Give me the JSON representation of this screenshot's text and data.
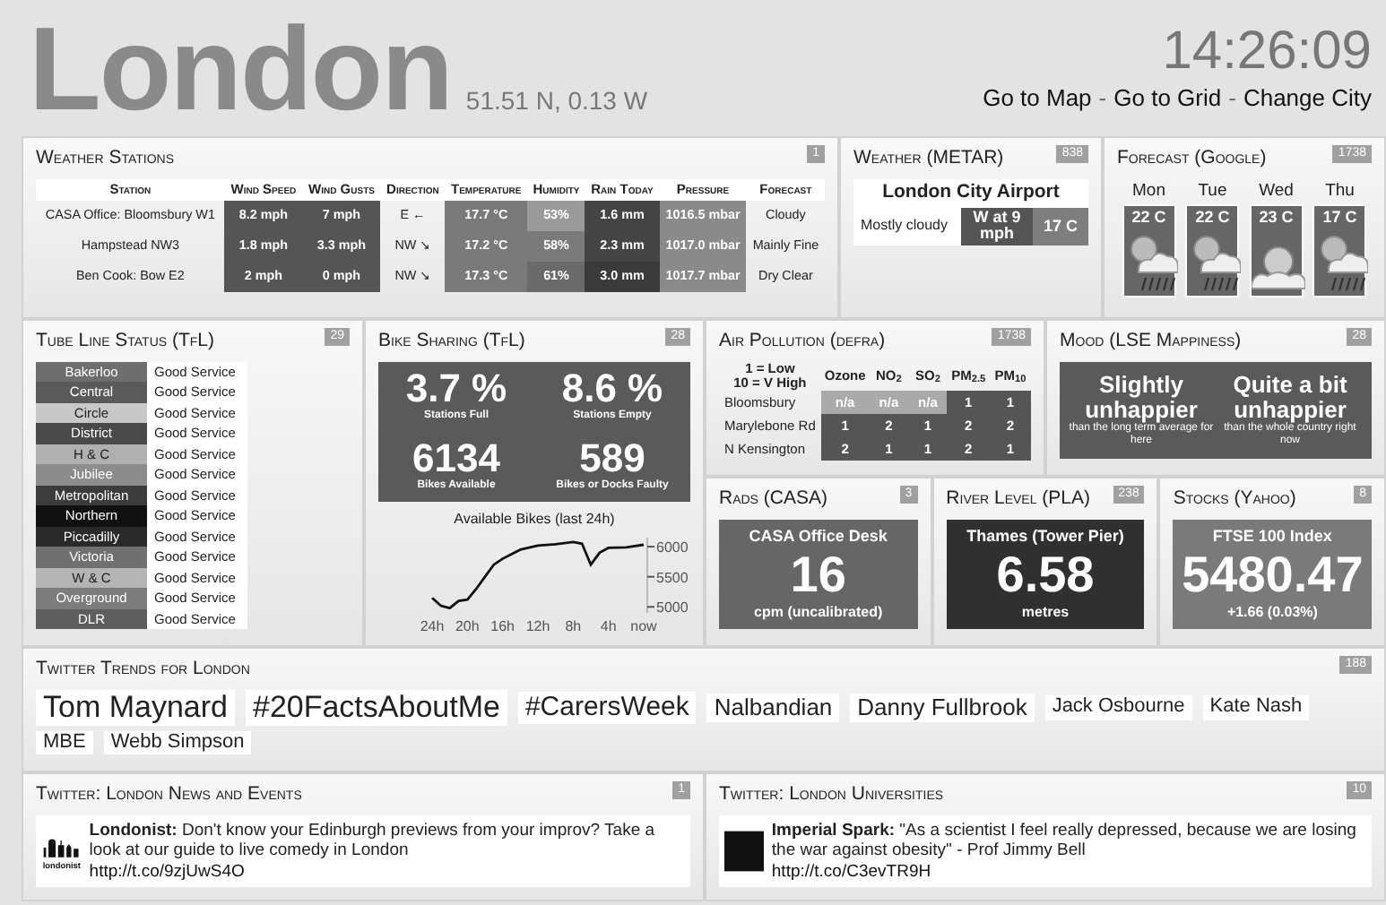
{
  "header": {
    "city": "London",
    "coords": "51.51 N, 0.13 W",
    "time": "14:26:09",
    "nav": [
      {
        "kind": "link",
        "text": "Go to Map"
      },
      {
        "kind": "separator",
        "text": "-"
      },
      {
        "kind": "link",
        "text": "Go to Grid"
      },
      {
        "kind": "separator",
        "text": "-"
      },
      {
        "kind": "link",
        "text": "Change City"
      }
    ]
  },
  "weather_stations": {
    "title": "Weather Stations",
    "badge": "1",
    "columns": [
      "Station",
      "Wind Speed",
      "Wind Gusts",
      "Direction",
      "Temperature",
      "Humidity",
      "Rain Today",
      "Pressure",
      "Forecast"
    ],
    "rows": [
      {
        "cells": [
          {
            "text": "CASA Office: Bloomsbury W1"
          },
          {
            "text": "8.2 mph",
            "color": "#555555"
          },
          {
            "text": "7 mph",
            "color": "#555555"
          },
          {
            "text": "E ←"
          },
          {
            "text": "17.7 °C",
            "color": "#7a7a7a"
          },
          {
            "text": "53%",
            "color": "#9a9a9a"
          },
          {
            "text": "1.6 mm",
            "color": "#444444"
          },
          {
            "text": "1016.5 mbar",
            "color": "#8a8a8a"
          },
          {
            "text": "Cloudy"
          }
        ]
      },
      {
        "cells": [
          {
            "text": "Hampstead NW3"
          },
          {
            "text": "1.8 mph",
            "color": "#555555"
          },
          {
            "text": "3.3 mph",
            "color": "#555555"
          },
          {
            "text": "NW ↘"
          },
          {
            "text": "17.2 °C",
            "color": "#7a7a7a"
          },
          {
            "text": "58%",
            "color": "#7a7a7a"
          },
          {
            "text": "2.3 mm",
            "color": "#444444"
          },
          {
            "text": "1017.0 mbar",
            "color": "#8a8a8a"
          },
          {
            "text": "Mainly Fine"
          }
        ]
      },
      {
        "cells": [
          {
            "text": "Ben Cook: Bow E2"
          },
          {
            "text": "2 mph",
            "color": "#555555"
          },
          {
            "text": "0 mph",
            "color": "#555555"
          },
          {
            "text": "NW ↘"
          },
          {
            "text": "17.3 °C",
            "color": "#7a7a7a"
          },
          {
            "text": "61%",
            "color": "#6a6a6a"
          },
          {
            "text": "3.0 mm",
            "color": "#3a3a3a"
          },
          {
            "text": "1017.7 mbar",
            "color": "#8a8a8a"
          },
          {
            "text": "Dry Clear"
          }
        ]
      }
    ]
  },
  "metar": {
    "title": "Weather (METAR)",
    "badge": "838",
    "station": "London City Airport",
    "condition": "Mostly cloudy",
    "wind": "W at 9 mph",
    "temperature": "17 C"
  },
  "forecast": {
    "title": "Forecast (Google)",
    "badge": "1738",
    "days": [
      {
        "day": "Mon",
        "temp": "22 C",
        "kind": "rain"
      },
      {
        "day": "Tue",
        "temp": "22 C",
        "kind": "rain"
      },
      {
        "day": "Wed",
        "temp": "23 C",
        "kind": "cloudy"
      },
      {
        "day": "Thu",
        "temp": "17 C",
        "kind": "rain"
      }
    ]
  },
  "tube": {
    "title": "Tube Line Status (TfL)",
    "badge": "29",
    "lines": [
      {
        "name": "Bakerloo",
        "status": "Good Service",
        "color": "#6e6e6e"
      },
      {
        "name": "Central",
        "status": "Good Service",
        "color": "#5a5a5a"
      },
      {
        "name": "Circle",
        "status": "Good Service",
        "color": "#c8c8c8"
      },
      {
        "name": "District",
        "status": "Good Service",
        "color": "#4a4a4a"
      },
      {
        "name": "H & C",
        "status": "Good Service",
        "color": "#b0b0b0"
      },
      {
        "name": "Jubilee",
        "status": "Good Service",
        "color": "#8c8c8c"
      },
      {
        "name": "Metropolitan",
        "status": "Good Service",
        "color": "#3c3c3c"
      },
      {
        "name": "Northern",
        "status": "Good Service",
        "color": "#111111"
      },
      {
        "name": "Piccadilly",
        "status": "Good Service",
        "color": "#2a2a2a"
      },
      {
        "name": "Victoria",
        "status": "Good Service",
        "color": "#707070"
      },
      {
        "name": "W & C",
        "status": "Good Service",
        "color": "#b4b4b4"
      },
      {
        "name": "Overground",
        "status": "Good Service",
        "color": "#7c7c7c"
      },
      {
        "name": "DLR",
        "status": "Good Service",
        "color": "#5e5e5e"
      }
    ]
  },
  "bikes": {
    "title": "Bike Sharing (TfL)",
    "badge": "28",
    "stats": [
      {
        "value": "3.7 %",
        "label": "Stations Full"
      },
      {
        "value": "8.6 %",
        "label": "Stations Empty"
      },
      {
        "value": "6134",
        "label": "Bikes Available"
      },
      {
        "value": "589",
        "label": "Bikes or Docks Faulty"
      }
    ],
    "chart_data": {
      "type": "line",
      "title": "Available Bikes (last 24h)",
      "x": [
        -24,
        -23,
        -22,
        -21,
        -20,
        -19,
        -18,
        -17,
        -16,
        -14,
        -12,
        -10,
        -8,
        -7,
        -6,
        -5,
        -4,
        -2,
        0
      ],
      "series": [
        {
          "color": "#111111",
          "values": [
            5150,
            5020,
            4980,
            5100,
            5120,
            5300,
            5500,
            5700,
            5800,
            5950,
            6020,
            6040,
            6080,
            6050,
            5700,
            5900,
            5980,
            5990,
            6030
          ]
        }
      ],
      "xlim": [
        -24,
        0
      ],
      "ylim": [
        4900,
        6150
      ],
      "xticks": [
        {
          "value": -24,
          "label": "24h"
        },
        {
          "value": -20,
          "label": "20h"
        },
        {
          "value": -16,
          "label": "16h"
        },
        {
          "value": -12,
          "label": "12h"
        },
        {
          "value": -8,
          "label": "8h"
        },
        {
          "value": -4,
          "label": "4h"
        },
        {
          "value": 0,
          "label": "now"
        }
      ],
      "yticks": [
        6000,
        5500,
        5000
      ]
    }
  },
  "air": {
    "title": "Air Pollution (defra)",
    "badge": "1738",
    "legend": [
      "1 = Low",
      "10 = V High"
    ],
    "columns": [
      "Ozone",
      "NO$_{2}$",
      "SO$_{2}$",
      "PM$_{2.5}$",
      "PM$_{10}$"
    ],
    "rows": [
      {
        "site": "Bloomsbury",
        "cells": [
          {
            "text": "n/a",
            "color": "#aaaaaa"
          },
          {
            "text": "n/a",
            "color": "#aaaaaa"
          },
          {
            "text": "n/a",
            "color": "#aaaaaa"
          },
          {
            "text": "1",
            "color": "#555555"
          },
          {
            "text": "1",
            "color": "#555555"
          }
        ]
      },
      {
        "site": "Marylebone Rd",
        "cells": [
          {
            "text": "1",
            "color": "#555555"
          },
          {
            "text": "2",
            "color": "#555555"
          },
          {
            "text": "1",
            "color": "#555555"
          },
          {
            "text": "2",
            "color": "#555555"
          },
          {
            "text": "2",
            "color": "#555555"
          }
        ]
      },
      {
        "site": "N Kensington",
        "cells": [
          {
            "text": "2",
            "color": "#555555"
          },
          {
            "text": "1",
            "color": "#555555"
          },
          {
            "text": "1",
            "color": "#555555"
          },
          {
            "text": "2",
            "color": "#555555"
          },
          {
            "text": "1",
            "color": "#555555"
          }
        ]
      }
    ]
  },
  "mood": {
    "title": "Mood (LSE Mappiness)",
    "badge": "28",
    "items": [
      {
        "headline": "Slightly unhappier",
        "detail": "than the long term average for here"
      },
      {
        "headline": "Quite a bit unhappier",
        "detail": "than the whole country right now"
      }
    ]
  },
  "gauges": [
    {
      "title": "Rads (CASA)",
      "badge": "3",
      "label": "CASA Office Desk",
      "value": "16",
      "unit": "cpm (uncalibrated)",
      "color": "#666666"
    },
    {
      "title": "River Level (PLA)",
      "badge": "238",
      "label": "Thames (Tower Pier)",
      "value": "6.58",
      "unit": "metres",
      "color": "#303030"
    },
    {
      "title": "Stocks (Yahoo)",
      "badge": "8",
      "label": "FTSE 100 Index",
      "value": "5480.47",
      "unit": "+1.66 (0.03%)",
      "color": "#7a7a7a"
    }
  ],
  "trends": {
    "title": "Twitter Trends for London",
    "badge": "188",
    "items": [
      {
        "text": "Tom Maynard",
        "kind": "xl"
      },
      {
        "text": "#20FactsAboutMe",
        "kind": "xl"
      },
      {
        "text": "#CarersWeek",
        "kind": "l"
      },
      {
        "text": "Nalbandian",
        "kind": "m"
      },
      {
        "text": "Danny Fullbrook",
        "kind": "m"
      },
      {
        "text": "Jack Osbourne",
        "kind": "s"
      },
      {
        "text": "Kate Nash",
        "kind": "s"
      },
      {
        "text": "MBE",
        "kind": "s"
      },
      {
        "text": "Webb Simpson",
        "kind": "s"
      }
    ]
  },
  "tweets": [
    {
      "title": "Twitter: London News and Events",
      "badge": "1",
      "kind": "logo",
      "logo_text": "londonist",
      "text": "**Londonist:** Don't know your Edinburgh previews from your improv? Take a look at our guide to live comedy in London",
      "link": "http://t.co/9zjUwS4O"
    },
    {
      "title": "Twitter: London Universities",
      "badge": "10",
      "kind": "photo",
      "text": "**Imperial Spark:** \"As a scientist I feel really depressed, because we are losing the war against obesity\" - Prof Jimmy Bell",
      "link": "http://t.co/C3evTR9H"
    }
  ]
}
